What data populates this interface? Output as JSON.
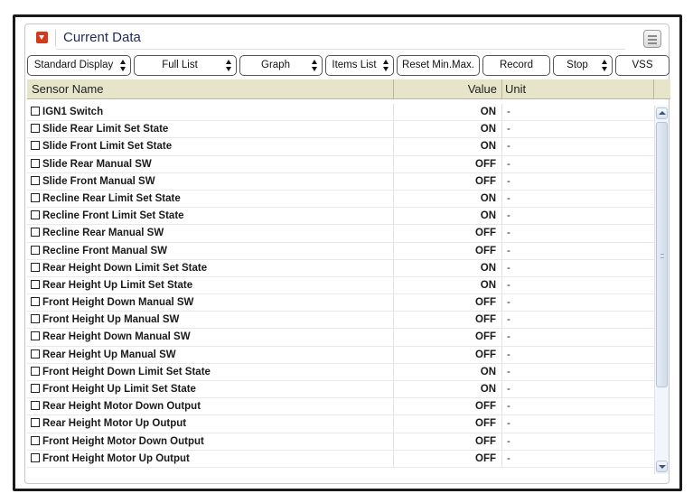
{
  "panel": {
    "title": "Current Data"
  },
  "toolbar": {
    "standard_display": "Standard Display",
    "full_list": "Full List",
    "graph": "Graph",
    "items_list": "Items List",
    "reset_min_max": "Reset Min.Max.",
    "record": "Record",
    "stop": "Stop",
    "vss": "VSS"
  },
  "columns": {
    "name": "Sensor Name",
    "value": "Value",
    "unit": "Unit"
  },
  "rows": [
    {
      "name": "IGN1 Switch",
      "value": "ON",
      "unit": "-"
    },
    {
      "name": "Slide Rear Limit Set State",
      "value": "ON",
      "unit": "-"
    },
    {
      "name": "Slide Front Limit Set State",
      "value": "ON",
      "unit": "-"
    },
    {
      "name": "Slide Rear Manual SW",
      "value": "OFF",
      "unit": "-"
    },
    {
      "name": "Slide Front Manual SW",
      "value": "OFF",
      "unit": "-"
    },
    {
      "name": "Recline Rear Limit Set State",
      "value": "ON",
      "unit": "-"
    },
    {
      "name": "Recline Front Limit Set State",
      "value": "ON",
      "unit": "-"
    },
    {
      "name": "Recline Rear Manual SW",
      "value": "OFF",
      "unit": "-"
    },
    {
      "name": "Recline Front Manual SW",
      "value": "OFF",
      "unit": "-"
    },
    {
      "name": "Rear Height Down Limit Set State",
      "value": "ON",
      "unit": "-"
    },
    {
      "name": "Rear Height Up Limit Set State",
      "value": "ON",
      "unit": "-"
    },
    {
      "name": "Front Height Down Manual SW",
      "value": "OFF",
      "unit": "-"
    },
    {
      "name": "Front Height Up Manual SW",
      "value": "OFF",
      "unit": "-"
    },
    {
      "name": "Rear Height Down Manual SW",
      "value": "OFF",
      "unit": "-"
    },
    {
      "name": "Rear Height Up Manual SW",
      "value": "OFF",
      "unit": "-"
    },
    {
      "name": "Front Height Down Limit Set State",
      "value": "ON",
      "unit": "-"
    },
    {
      "name": "Front Height Up Limit Set State",
      "value": "ON",
      "unit": "-"
    },
    {
      "name": "Rear Height Motor Down Output",
      "value": "OFF",
      "unit": "-"
    },
    {
      "name": "Rear Height Motor Up Output",
      "value": "OFF",
      "unit": "-"
    },
    {
      "name": "Front Height Motor Down Output",
      "value": "OFF",
      "unit": "-"
    },
    {
      "name": "Front Height Motor Up Output",
      "value": "OFF",
      "unit": "-"
    }
  ],
  "colors": {
    "header_bg": "#e6e5c9",
    "title": "#1e2a5a",
    "collapse_icon": "#d43a1a"
  }
}
